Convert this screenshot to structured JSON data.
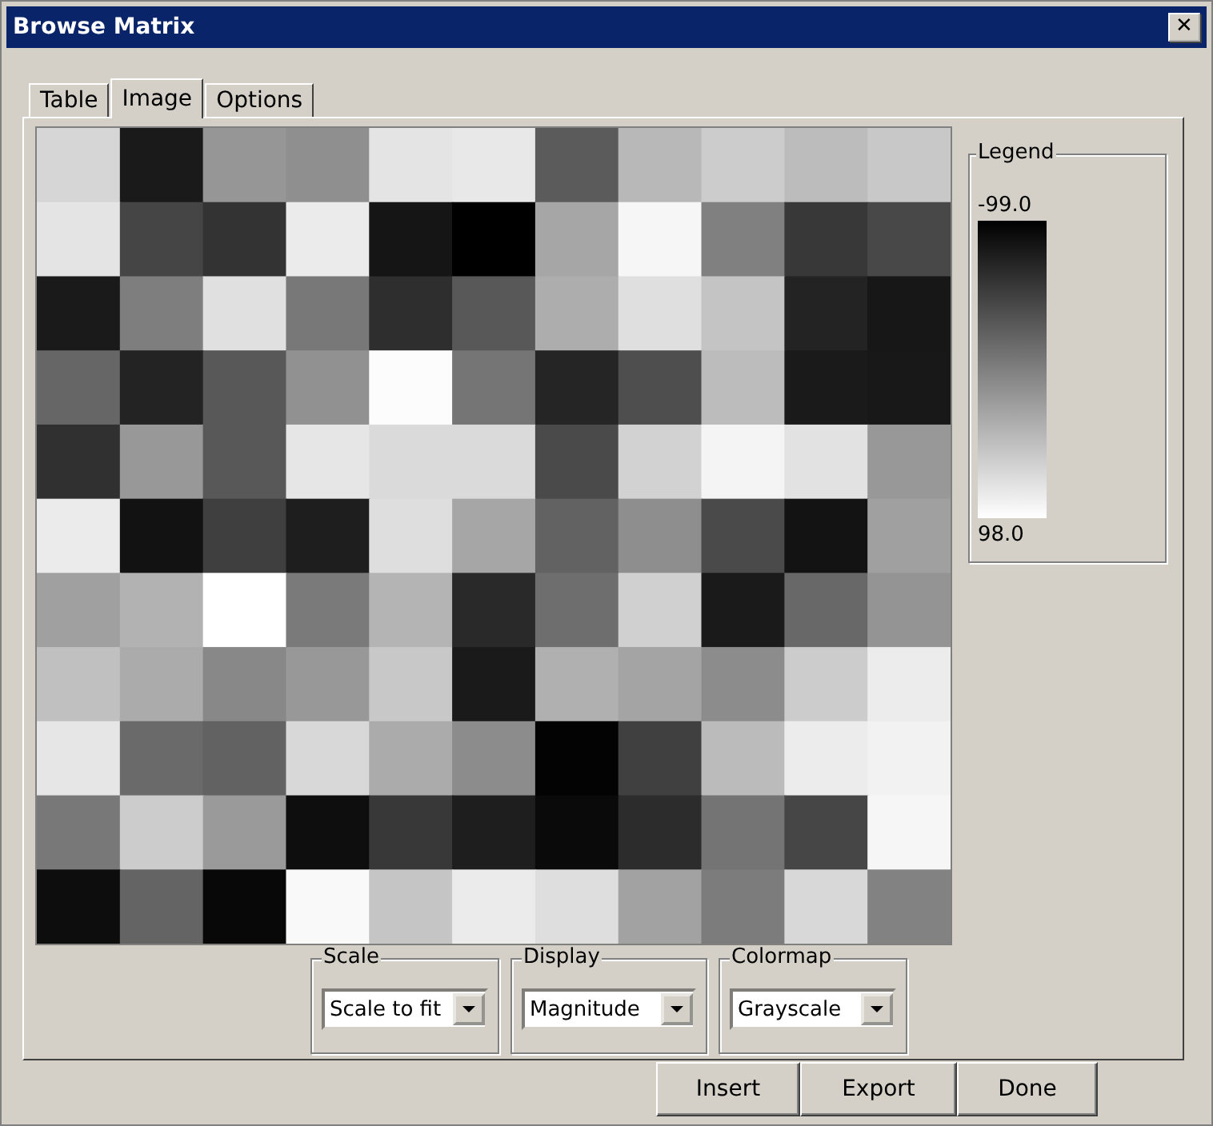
{
  "window": {
    "title": "Browse Matrix",
    "close_glyph": "✕"
  },
  "tabs": [
    {
      "label": "Table",
      "selected": false
    },
    {
      "label": "Image",
      "selected": true
    },
    {
      "label": "Options",
      "selected": false
    }
  ],
  "legend": {
    "title": "Legend",
    "max_label": "-99.0",
    "min_label": "98.0"
  },
  "selectors": [
    {
      "label": "Scale",
      "value": "Scale to fit"
    },
    {
      "label": "Display",
      "value": "Magnitude"
    },
    {
      "label": "Colormap",
      "value": "Grayscale"
    }
  ],
  "buttons": [
    "Insert",
    "Export",
    "Done"
  ]
}
